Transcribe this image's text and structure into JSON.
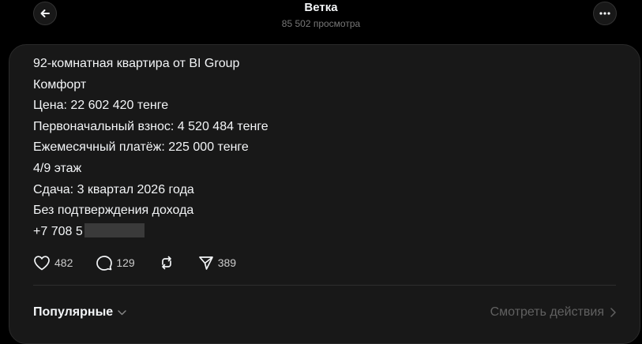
{
  "header": {
    "title": "Ветка",
    "views": "85 502 просмотра",
    "back_icon": "arrow-left-icon",
    "more_icon": "ellipsis-icon"
  },
  "post": {
    "lines": [
      "92-комнатная квартира от BI Group",
      "Комфорт",
      "Цена: 22 602 420 тенге",
      "Первоначальный взнос: 4 520 484 тенге",
      "Ежемесячный платёж: 225 000 тенге",
      "4/9 этаж",
      "Сдача: 3 квартал 2026 года",
      "Без подтверждения дохода"
    ],
    "phone_visible": "+7 708 5"
  },
  "actions": {
    "likes": "482",
    "comments": "129",
    "shares": "389"
  },
  "footer": {
    "popular_label": "Популярные",
    "see_actions_label": "Смотреть действия"
  },
  "colors": {
    "background": "#000000",
    "card": "#181818",
    "text": "#f3f5f7",
    "muted": "#616161"
  }
}
